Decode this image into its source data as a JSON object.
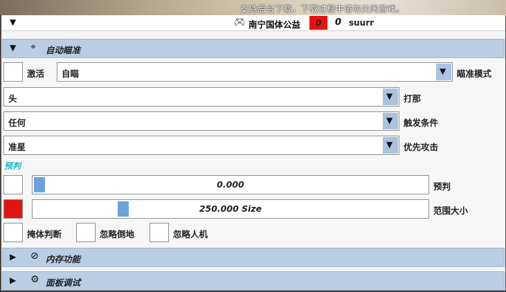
{
  "banner": "支持后台下载，下载过程中请勿关闭游戏。",
  "titlebar": {
    "collapse_icon": "triangle-down",
    "gamepad_icon": "gamepad",
    "title": "南宁国体公益",
    "red_value": "0",
    "counter": "0",
    "user": "suurr"
  },
  "aim_section": {
    "expand_icon": "triangle-down",
    "icon": "crosshair",
    "label": "自动瞄准"
  },
  "activate": {
    "label": "激活",
    "checked": false
  },
  "aim_mode": {
    "value": "自瞄",
    "label": "瞄准模式"
  },
  "hit_part": {
    "value": "头",
    "label": "打那"
  },
  "trigger": {
    "value": "任何",
    "label": "触发条件"
  },
  "priority": {
    "value": "准星",
    "label": "优先攻击"
  },
  "prediction_header": "预判",
  "prediction_slider": {
    "text": "0.000",
    "value": 0.0,
    "label": "预判"
  },
  "range_slider": {
    "text": "250.000 Size",
    "fraction": 0.22,
    "label": "范围大小",
    "swatch_color": "#e21414"
  },
  "checks": [
    {
      "label": "掩体判断",
      "checked": false
    },
    {
      "label": "忽略倒地",
      "checked": false
    },
    {
      "label": "忽略人机",
      "checked": false
    }
  ],
  "memory_section": {
    "expand_icon": "triangle-right",
    "icon": "ban-circle",
    "label": "内存功能"
  },
  "panel_section": {
    "expand_icon": "triangle-right",
    "icon": "gear",
    "label": "面板调试"
  },
  "colors": {
    "section_bg": "#b9cde3",
    "arrow_bg": "#a9c3e1",
    "thumb": "#6aa2dd",
    "accent_teal": "#22b8c8",
    "red": "#e81010"
  }
}
